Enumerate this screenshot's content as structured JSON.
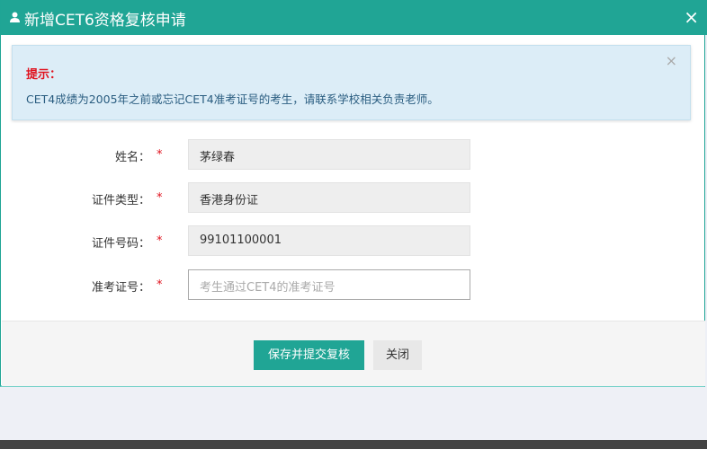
{
  "dialog": {
    "title": "新增CET6资格复核申请",
    "close": "×",
    "user_icon": "user-icon"
  },
  "alert": {
    "heading": "提示：",
    "message": "CET4成绩为2005年之前或忘记CET4准考证号的考生，请联系学校相关负责老师。",
    "close": "×"
  },
  "form": {
    "required_mark": "*",
    "fields": [
      {
        "label": "姓名：",
        "value": "茅绿春"
      },
      {
        "label": "证件类型：",
        "value": "香港身份证"
      },
      {
        "label": "证件号码：",
        "value": "99101100001"
      },
      {
        "label": "准考证号：",
        "value": "",
        "placeholder": "考生通过CET4的准考证号"
      }
    ]
  },
  "footer": {
    "save_label": "保存并提交复核",
    "close_label": "关闭"
  },
  "colors": {
    "primary": "#20a595",
    "required": "#e0121e"
  }
}
